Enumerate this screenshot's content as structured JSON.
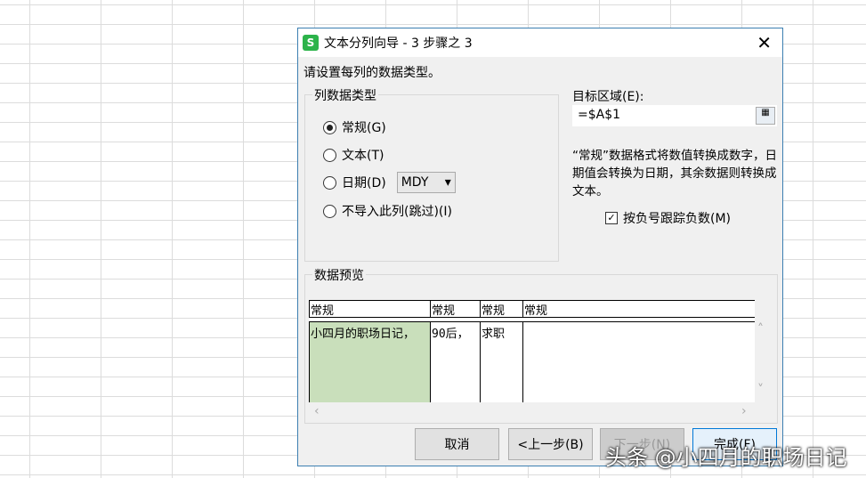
{
  "dialog": {
    "title": "文本分列向导 - 3 步骤之 3",
    "logo": "S",
    "close": "✕",
    "instruction": "请设置每列的数据类型。",
    "column_type_group": "列数据类型",
    "options": [
      {
        "label": "常规(G)",
        "checked": true
      },
      {
        "label": "文本(T)",
        "checked": false
      },
      {
        "label": "日期(D)",
        "checked": false
      },
      {
        "label": "不导入此列(跳过)(I)",
        "checked": false
      }
    ],
    "date_format": "MDY",
    "target_label": "目标区域(E):",
    "target_value": "=$A$1",
    "description": "“常规”数据格式将数值转换成数字，日期值会转换为日期，其余数据则转换成文本。",
    "negative_checkbox": {
      "label": "按负号跟踪负数(M)",
      "checked": true
    },
    "preview_label": "数据预览",
    "preview_headers": [
      "常规",
      "常规",
      "常规",
      "常规"
    ],
    "preview_row": [
      "小四月的职场日记，",
      "90后，",
      "求职",
      ""
    ],
    "buttons": {
      "cancel": "取消",
      "back": "<上一步(B)",
      "next": "下一步(N)",
      "finish": "完成(F)"
    }
  },
  "watermark": "头条 @小四月的职场日记"
}
